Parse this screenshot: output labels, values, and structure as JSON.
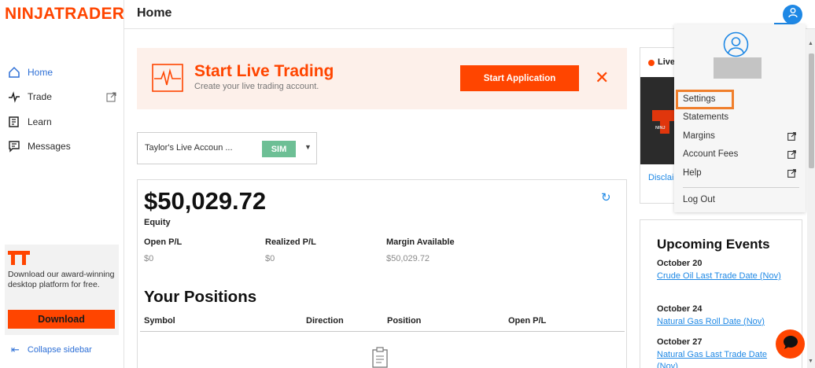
{
  "brand": {
    "logo_text": "NINJATRADER",
    "accent": "#ff4500",
    "link_color": "#1e88e5"
  },
  "sidebar": {
    "items": [
      {
        "label": "Home",
        "icon": "home-icon",
        "active": true
      },
      {
        "label": "Trade",
        "icon": "pulse-icon",
        "external": true
      },
      {
        "label": "Learn",
        "icon": "book-icon"
      },
      {
        "label": "Messages",
        "icon": "message-icon"
      }
    ],
    "promo": {
      "text": "Download our award-winning desktop platform for free.",
      "button": "Download",
      "icon": "nt-logo-icon"
    },
    "collapse": {
      "label": "Collapse sidebar",
      "icon": "collapse-arrow-icon"
    }
  },
  "header": {
    "title": "Home",
    "user_icon": "user-icon"
  },
  "banner": {
    "title": "Start Live Trading",
    "subtitle": "Create your live trading account.",
    "button": "Start Application",
    "close_icon": "close-icon",
    "icon": "heartbeat-icon"
  },
  "account_select": {
    "name": "Taylor's Live Accoun ...",
    "badge": "SIM",
    "badge_color": "#6dbf95"
  },
  "account": {
    "equity_value": "$50,029.72",
    "equity_label": "Equity",
    "stats": [
      {
        "label": "Open P/L",
        "value": "$0"
      },
      {
        "label": "Realized P/L",
        "value": "$0"
      },
      {
        "label": "Margin Available",
        "value": "$50,029.72"
      }
    ]
  },
  "positions": {
    "title": "Your Positions",
    "columns": [
      "Symbol",
      "Direction",
      "Position",
      "Open P/L"
    ]
  },
  "live": {
    "label": "Live",
    "disclaimer": "Disclai"
  },
  "events": {
    "title": "Upcoming Events",
    "items": [
      {
        "date": "October 20",
        "link": "Crude Oil Last Trade Date (Nov)"
      },
      {
        "date": "October 24",
        "link": "Natural Gas Roll Date (Nov)"
      },
      {
        "date": "October 27",
        "link": "Natural Gas Last Trade Date (Nov)"
      }
    ]
  },
  "user_menu": {
    "items": [
      {
        "label": "Settings",
        "highlighted": true
      },
      {
        "label": "Statements"
      },
      {
        "label": "Margins",
        "external": true
      },
      {
        "label": "Account Fees",
        "external": true
      },
      {
        "label": "Help",
        "external": true
      },
      {
        "label": "Log Out"
      }
    ],
    "highlight_color": "#f07f2c"
  }
}
